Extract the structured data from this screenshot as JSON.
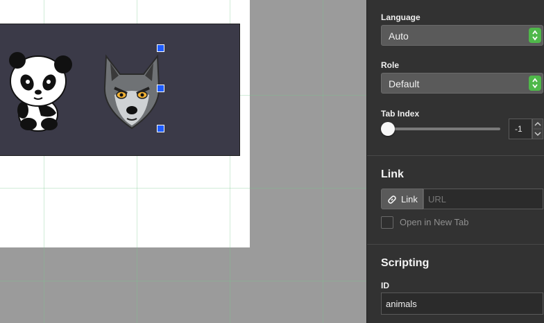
{
  "inspector": {
    "language": {
      "label": "Language",
      "value": "Auto"
    },
    "role": {
      "label": "Role",
      "value": "Default"
    },
    "tab_index": {
      "label": "Tab Index",
      "value": "-1",
      "slider_fraction": 0
    },
    "link_section": {
      "title": "Link",
      "link_button_label": "Link",
      "url_placeholder": "URL",
      "url_value": "",
      "open_new_tab_label": "Open in New Tab",
      "open_new_tab_checked": false
    },
    "scripting": {
      "title": "Scripting",
      "id_label": "ID",
      "id_value": "animals"
    }
  },
  "canvas": {
    "image_icons": [
      "panda-icon",
      "wolf-icon"
    ]
  },
  "colors": {
    "accent_green": "#4fb84a",
    "selection_handle": "#1e5cff",
    "panel_bg": "#323232",
    "canvas_bg": "#9b9b9b"
  }
}
